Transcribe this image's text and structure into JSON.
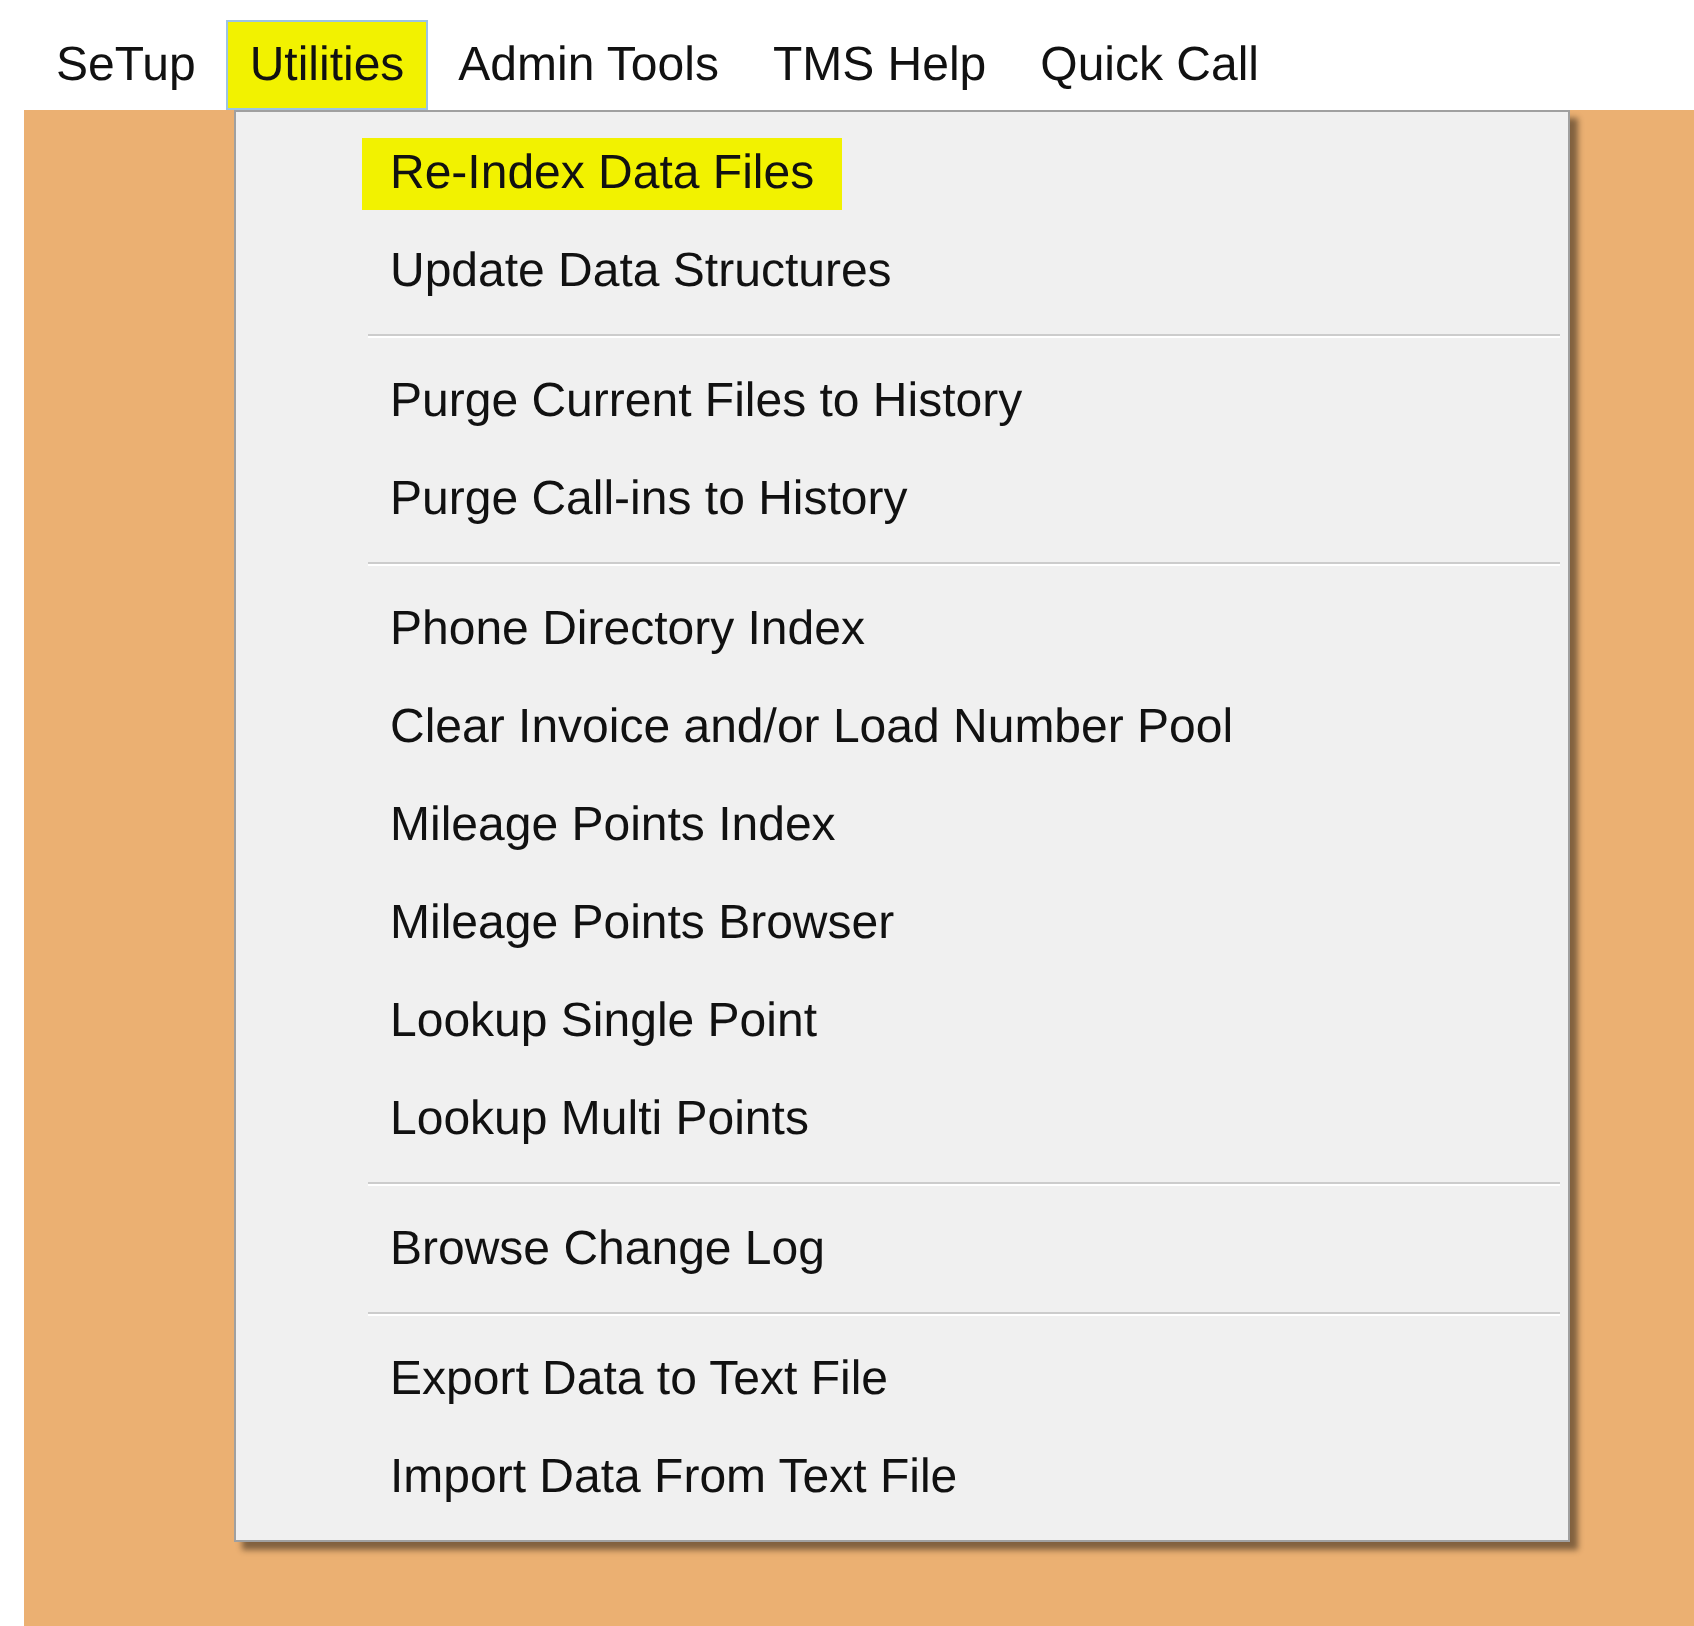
{
  "menu_bar": [
    {
      "label": "SeTup",
      "selected": false
    },
    {
      "label": "Utilities",
      "selected": true
    },
    {
      "label": "Admin Tools",
      "selected": false
    },
    {
      "label": "TMS Help",
      "selected": false
    },
    {
      "label": "Quick Call",
      "selected": false
    }
  ],
  "dropdown": {
    "groups": [
      {
        "items": [
          {
            "label": "Re-Index Data Files",
            "highlighted": true
          },
          {
            "label": "Update Data Structures",
            "highlighted": false
          }
        ]
      },
      {
        "items": [
          {
            "label": "Purge Current Files to History",
            "highlighted": false
          },
          {
            "label": "Purge Call-ins to History",
            "highlighted": false
          }
        ]
      },
      {
        "items": [
          {
            "label": "Phone Directory Index",
            "highlighted": false
          },
          {
            "label": "Clear Invoice and/or Load Number Pool",
            "highlighted": false
          },
          {
            "label": "Mileage Points Index",
            "highlighted": false
          },
          {
            "label": "Mileage Points Browser",
            "highlighted": false
          },
          {
            "label": "Lookup Single Point",
            "highlighted": false
          },
          {
            "label": "Lookup Multi Points",
            "highlighted": false
          }
        ]
      },
      {
        "items": [
          {
            "label": "Browse Change Log",
            "highlighted": false
          }
        ]
      },
      {
        "items": [
          {
            "label": "Export Data to Text File",
            "highlighted": false
          },
          {
            "label": "Import Data From Text File",
            "highlighted": false
          }
        ]
      }
    ]
  }
}
